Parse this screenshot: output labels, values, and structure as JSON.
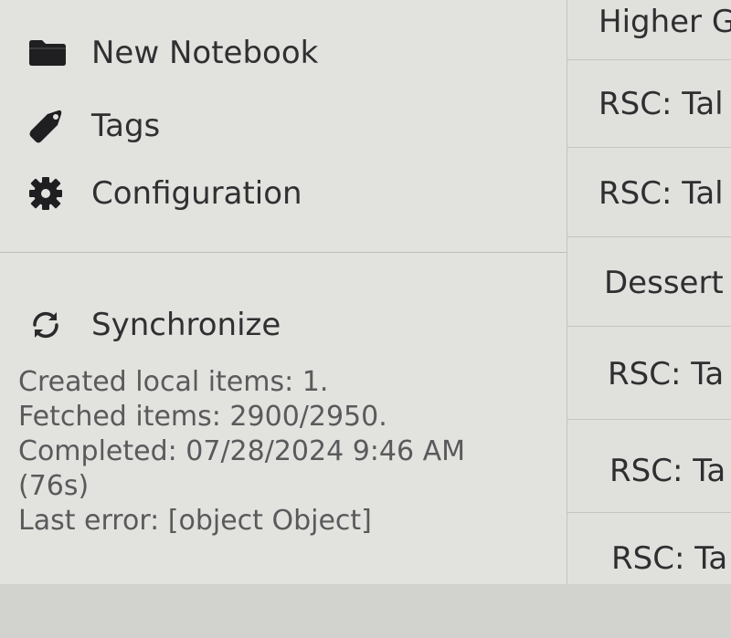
{
  "sidebar": {
    "menu": [
      {
        "label": "New Notebook",
        "icon": "folder-icon"
      },
      {
        "label": "Tags",
        "icon": "tag-icon"
      },
      {
        "label": "Configuration",
        "icon": "gear-icon"
      }
    ],
    "sync": {
      "label": "Synchronize",
      "icon": "sync-icon",
      "status_lines": [
        "Created local items: 1.",
        "Fetched items: 2900/2950.",
        "Completed: 07/28/2024 9:46 AM",
        "(76s)",
        "Last error: [object Object]"
      ]
    }
  },
  "notes": [
    {
      "title": "Higher Gr"
    },
    {
      "title": "RSC: Tal"
    },
    {
      "title": "RSC: Tal"
    },
    {
      "title": "Dessert"
    },
    {
      "title": "RSC: Ta"
    },
    {
      "title": "RSC: Ta"
    },
    {
      "title": "RSC: Ta"
    }
  ],
  "colors": {
    "sidebar_bg": "#e2e2df",
    "text": "#303032",
    "status_text": "#5a5a5c",
    "divider": "#bcbcb9"
  }
}
